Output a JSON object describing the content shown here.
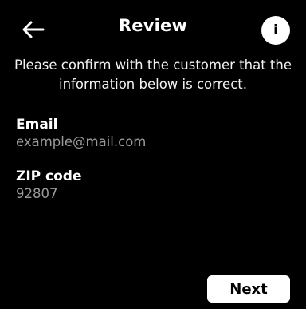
{
  "header": {
    "title": "Review",
    "back_icon": "arrow-left-icon",
    "info_label": "i",
    "info_icon": "info-icon"
  },
  "message": "Please confirm with the customer that the information below is correct.",
  "fields": [
    {
      "label": "Email",
      "value": "example@mail.com"
    },
    {
      "label": "ZIP code",
      "value": "92807"
    }
  ],
  "footer": {
    "next_label": "Next"
  },
  "colors": {
    "background": "#000000",
    "text": "#ffffff",
    "value_text": "#9a9a9a",
    "button_bg": "#ffffff"
  }
}
